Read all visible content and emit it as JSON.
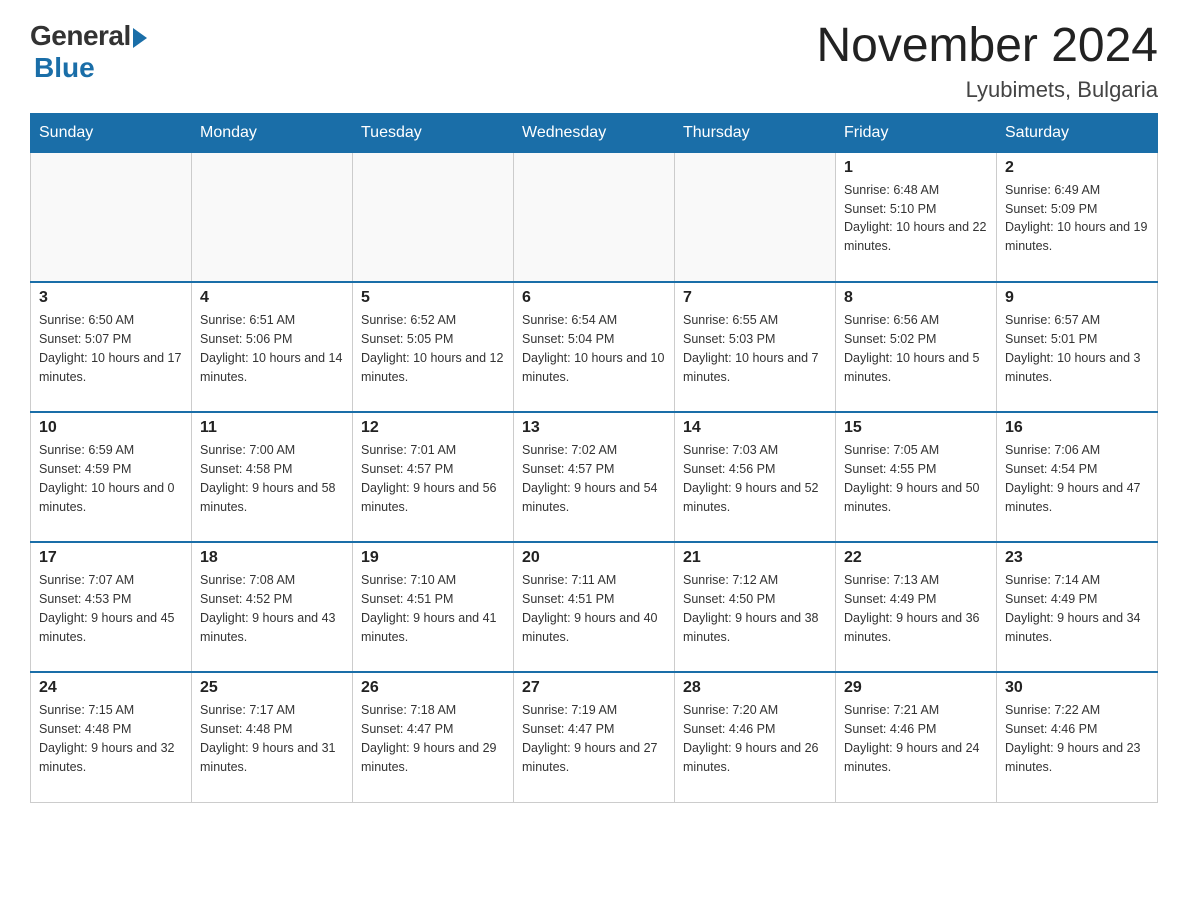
{
  "header": {
    "logo_general": "General",
    "logo_blue": "Blue",
    "month_title": "November 2024",
    "location": "Lyubimets, Bulgaria"
  },
  "weekdays": [
    "Sunday",
    "Monday",
    "Tuesday",
    "Wednesday",
    "Thursday",
    "Friday",
    "Saturday"
  ],
  "weeks": [
    [
      {
        "day": "",
        "sunrise": "",
        "sunset": "",
        "daylight": ""
      },
      {
        "day": "",
        "sunrise": "",
        "sunset": "",
        "daylight": ""
      },
      {
        "day": "",
        "sunrise": "",
        "sunset": "",
        "daylight": ""
      },
      {
        "day": "",
        "sunrise": "",
        "sunset": "",
        "daylight": ""
      },
      {
        "day": "",
        "sunrise": "",
        "sunset": "",
        "daylight": ""
      },
      {
        "day": "1",
        "sunrise": "Sunrise: 6:48 AM",
        "sunset": "Sunset: 5:10 PM",
        "daylight": "Daylight: 10 hours and 22 minutes."
      },
      {
        "day": "2",
        "sunrise": "Sunrise: 6:49 AM",
        "sunset": "Sunset: 5:09 PM",
        "daylight": "Daylight: 10 hours and 19 minutes."
      }
    ],
    [
      {
        "day": "3",
        "sunrise": "Sunrise: 6:50 AM",
        "sunset": "Sunset: 5:07 PM",
        "daylight": "Daylight: 10 hours and 17 minutes."
      },
      {
        "day": "4",
        "sunrise": "Sunrise: 6:51 AM",
        "sunset": "Sunset: 5:06 PM",
        "daylight": "Daylight: 10 hours and 14 minutes."
      },
      {
        "day": "5",
        "sunrise": "Sunrise: 6:52 AM",
        "sunset": "Sunset: 5:05 PM",
        "daylight": "Daylight: 10 hours and 12 minutes."
      },
      {
        "day": "6",
        "sunrise": "Sunrise: 6:54 AM",
        "sunset": "Sunset: 5:04 PM",
        "daylight": "Daylight: 10 hours and 10 minutes."
      },
      {
        "day": "7",
        "sunrise": "Sunrise: 6:55 AM",
        "sunset": "Sunset: 5:03 PM",
        "daylight": "Daylight: 10 hours and 7 minutes."
      },
      {
        "day": "8",
        "sunrise": "Sunrise: 6:56 AM",
        "sunset": "Sunset: 5:02 PM",
        "daylight": "Daylight: 10 hours and 5 minutes."
      },
      {
        "day": "9",
        "sunrise": "Sunrise: 6:57 AM",
        "sunset": "Sunset: 5:01 PM",
        "daylight": "Daylight: 10 hours and 3 minutes."
      }
    ],
    [
      {
        "day": "10",
        "sunrise": "Sunrise: 6:59 AM",
        "sunset": "Sunset: 4:59 PM",
        "daylight": "Daylight: 10 hours and 0 minutes."
      },
      {
        "day": "11",
        "sunrise": "Sunrise: 7:00 AM",
        "sunset": "Sunset: 4:58 PM",
        "daylight": "Daylight: 9 hours and 58 minutes."
      },
      {
        "day": "12",
        "sunrise": "Sunrise: 7:01 AM",
        "sunset": "Sunset: 4:57 PM",
        "daylight": "Daylight: 9 hours and 56 minutes."
      },
      {
        "day": "13",
        "sunrise": "Sunrise: 7:02 AM",
        "sunset": "Sunset: 4:57 PM",
        "daylight": "Daylight: 9 hours and 54 minutes."
      },
      {
        "day": "14",
        "sunrise": "Sunrise: 7:03 AM",
        "sunset": "Sunset: 4:56 PM",
        "daylight": "Daylight: 9 hours and 52 minutes."
      },
      {
        "day": "15",
        "sunrise": "Sunrise: 7:05 AM",
        "sunset": "Sunset: 4:55 PM",
        "daylight": "Daylight: 9 hours and 50 minutes."
      },
      {
        "day": "16",
        "sunrise": "Sunrise: 7:06 AM",
        "sunset": "Sunset: 4:54 PM",
        "daylight": "Daylight: 9 hours and 47 minutes."
      }
    ],
    [
      {
        "day": "17",
        "sunrise": "Sunrise: 7:07 AM",
        "sunset": "Sunset: 4:53 PM",
        "daylight": "Daylight: 9 hours and 45 minutes."
      },
      {
        "day": "18",
        "sunrise": "Sunrise: 7:08 AM",
        "sunset": "Sunset: 4:52 PM",
        "daylight": "Daylight: 9 hours and 43 minutes."
      },
      {
        "day": "19",
        "sunrise": "Sunrise: 7:10 AM",
        "sunset": "Sunset: 4:51 PM",
        "daylight": "Daylight: 9 hours and 41 minutes."
      },
      {
        "day": "20",
        "sunrise": "Sunrise: 7:11 AM",
        "sunset": "Sunset: 4:51 PM",
        "daylight": "Daylight: 9 hours and 40 minutes."
      },
      {
        "day": "21",
        "sunrise": "Sunrise: 7:12 AM",
        "sunset": "Sunset: 4:50 PM",
        "daylight": "Daylight: 9 hours and 38 minutes."
      },
      {
        "day": "22",
        "sunrise": "Sunrise: 7:13 AM",
        "sunset": "Sunset: 4:49 PM",
        "daylight": "Daylight: 9 hours and 36 minutes."
      },
      {
        "day": "23",
        "sunrise": "Sunrise: 7:14 AM",
        "sunset": "Sunset: 4:49 PM",
        "daylight": "Daylight: 9 hours and 34 minutes."
      }
    ],
    [
      {
        "day": "24",
        "sunrise": "Sunrise: 7:15 AM",
        "sunset": "Sunset: 4:48 PM",
        "daylight": "Daylight: 9 hours and 32 minutes."
      },
      {
        "day": "25",
        "sunrise": "Sunrise: 7:17 AM",
        "sunset": "Sunset: 4:48 PM",
        "daylight": "Daylight: 9 hours and 31 minutes."
      },
      {
        "day": "26",
        "sunrise": "Sunrise: 7:18 AM",
        "sunset": "Sunset: 4:47 PM",
        "daylight": "Daylight: 9 hours and 29 minutes."
      },
      {
        "day": "27",
        "sunrise": "Sunrise: 7:19 AM",
        "sunset": "Sunset: 4:47 PM",
        "daylight": "Daylight: 9 hours and 27 minutes."
      },
      {
        "day": "28",
        "sunrise": "Sunrise: 7:20 AM",
        "sunset": "Sunset: 4:46 PM",
        "daylight": "Daylight: 9 hours and 26 minutes."
      },
      {
        "day": "29",
        "sunrise": "Sunrise: 7:21 AM",
        "sunset": "Sunset: 4:46 PM",
        "daylight": "Daylight: 9 hours and 24 minutes."
      },
      {
        "day": "30",
        "sunrise": "Sunrise: 7:22 AM",
        "sunset": "Sunset: 4:46 PM",
        "daylight": "Daylight: 9 hours and 23 minutes."
      }
    ]
  ]
}
